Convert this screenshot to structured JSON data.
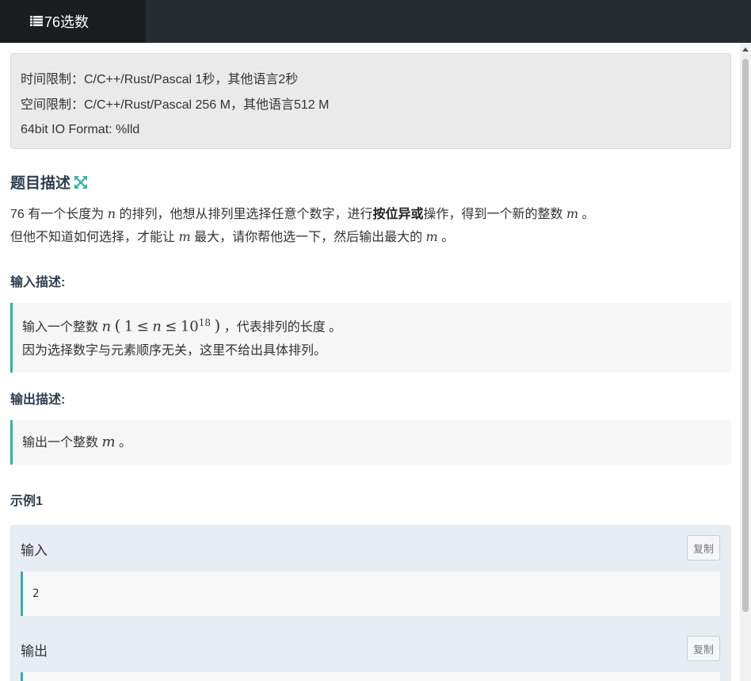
{
  "tab": {
    "title": "76选数"
  },
  "limits": {
    "time": "时间限制：C/C++/Rust/Pascal 1秒，其他语言2秒",
    "space": "空间限制：C/C++/Rust/Pascal 256 M，其他语言512 M",
    "format": "64bit IO Format: %lld"
  },
  "description": {
    "title": "题目描述",
    "line1_a": "76 有一个长度为 ",
    "var_n": "n",
    "line1_b": " 的排列，他想从排列里选择任意个数字，进行",
    "bold_op": "按位异或",
    "line1_c": "操作，得到一个新的整数 ",
    "var_m": "m",
    "line1_d": " 。",
    "line2_a": "但他不知道如何选择，才能让 ",
    "line2_b": " 最大，请你帮他选一下，然后输出最大的 ",
    "line2_c": " 。"
  },
  "input": {
    "title": "输入描述:",
    "line1_a": "输入一个整数 ",
    "var_n": "n",
    "range_open": "(",
    "range_one": "1",
    "le1": "≤",
    "range_n": "n",
    "le2": "≤",
    "base": "10",
    "exp": "18",
    "range_close": ")",
    "line1_b": " ，代表排列的长度 。",
    "line2": "因为选择数字与元素顺序无关，这里不给出具体排列。"
  },
  "output": {
    "title": "输出描述:",
    "line1_a": "输出一个整数 ",
    "var_m": "m",
    "line1_b": " 。"
  },
  "example": {
    "title": "示例1",
    "input_label": "输入",
    "input_value": "2",
    "output_label": "输出",
    "copy_label": "复制"
  },
  "colors": {
    "accent": "#31b2a5",
    "topbar": "#272c30",
    "title": "#2d3e50"
  }
}
